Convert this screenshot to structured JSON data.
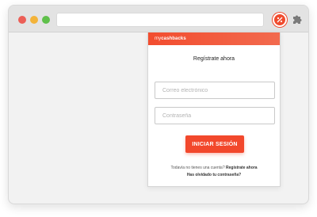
{
  "browser": {
    "extension_icon": "mycashbacks-extension-icon",
    "extensions_menu_icon": "puzzle-icon"
  },
  "popup": {
    "logo": {
      "prefix": "my",
      "brand": "cashbacks"
    },
    "title": "Regístrate ahora",
    "email": {
      "placeholder": "Correo electrónico",
      "value": ""
    },
    "password": {
      "placeholder": "Contraseña",
      "value": ""
    },
    "login_button_label": "INICIAR SESIÓN",
    "no_account_text": "Todavía no tienes una cuenta?",
    "register_link": "Regístrate ahora",
    "forgot_password_link": "Has olvidado tu contraseña?"
  },
  "colors": {
    "brand": "#f2482c",
    "window_bg": "#f2f2f2",
    "titlebar": "#e3e3e3"
  }
}
